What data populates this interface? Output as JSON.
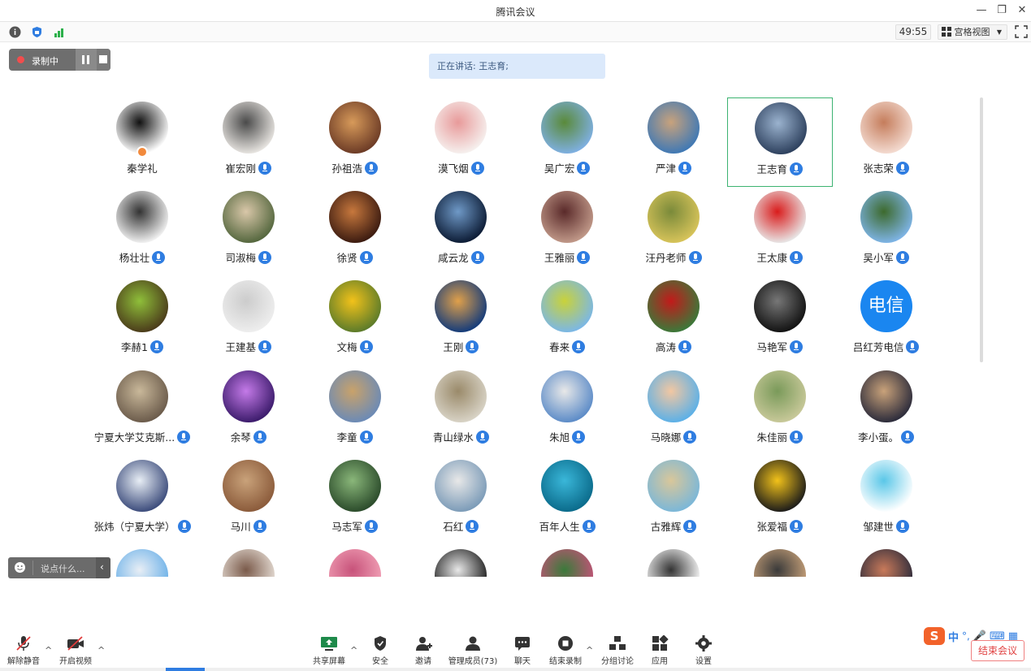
{
  "window": {
    "title": "腾讯会议"
  },
  "toolbar": {
    "timer": "49:55",
    "view_label": "宫格视图"
  },
  "recording": {
    "label": "录制中"
  },
  "speaking": "正在讲话: 王志育;",
  "chat_placeholder": "说点什么...",
  "participants": [
    {
      "name": "秦学礼",
      "colors": [
        "#ffffff",
        "#111111"
      ],
      "host": true
    },
    {
      "name": "崔宏刚",
      "colors": [
        "#e9e6e2",
        "#4a4a4a"
      ]
    },
    {
      "name": "孙祖浩",
      "colors": [
        "#6b3a25",
        "#d79a5a"
      ]
    },
    {
      "name": "漠飞烟",
      "colors": [
        "#f6f1ef",
        "#e89a9a"
      ]
    },
    {
      "name": "吴广宏",
      "colors": [
        "#7fb0e3",
        "#5a8a3a"
      ]
    },
    {
      "name": "严津",
      "colors": [
        "#3e78b5",
        "#c8a27c"
      ]
    },
    {
      "name": "王志育",
      "colors": [
        "#2c3f5c",
        "#9bb3cf"
      ],
      "active": true
    },
    {
      "name": "张志荣",
      "colors": [
        "#f4dcd2",
        "#c57d5c"
      ]
    },
    {
      "name": "杨壮壮",
      "colors": [
        "#f3f3f3",
        "#333333"
      ]
    },
    {
      "name": "司淑梅",
      "colors": [
        "#53663d",
        "#d9c7a9"
      ]
    },
    {
      "name": "徐贤",
      "colors": [
        "#3a1a10",
        "#c7783d"
      ]
    },
    {
      "name": "咸云龙",
      "colors": [
        "#0b1a33",
        "#6f99c7"
      ]
    },
    {
      "name": "王雅丽",
      "colors": [
        "#c29a8a",
        "#5a2a2a"
      ]
    },
    {
      "name": "汪丹老师",
      "colors": [
        "#d8c45a",
        "#7a8a3a"
      ]
    },
    {
      "name": "王太康",
      "colors": [
        "#e8e8e8",
        "#d91c1c"
      ]
    },
    {
      "name": "吴小军",
      "colors": [
        "#7fb5e8",
        "#3d6a2d"
      ]
    },
    {
      "name": "李赫1",
      "colors": [
        "#4a3a1a",
        "#8fbf3a"
      ]
    },
    {
      "name": "王建基",
      "colors": [
        "#eeeeee",
        "#cccccc"
      ]
    },
    {
      "name": "文梅",
      "colors": [
        "#5a7a2a",
        "#f2c21a"
      ]
    },
    {
      "name": "王刚",
      "colors": [
        "#123a7a",
        "#e0a04a"
      ]
    },
    {
      "name": "春来",
      "colors": [
        "#7ab7e8",
        "#c9d23a"
      ]
    },
    {
      "name": "高涛",
      "colors": [
        "#3a7a3a",
        "#c21a1a"
      ]
    },
    {
      "name": "马艳军",
      "colors": [
        "#111111",
        "#777777"
      ]
    },
    {
      "name": "吕红芳电信",
      "avatar_text": "电信",
      "colors": [
        "#1a86f0",
        "#1a86f0"
      ]
    },
    {
      "name": "宁夏大学艾克斯...",
      "colors": [
        "#6a5a4a",
        "#c9b89a"
      ]
    },
    {
      "name": "余琴",
      "colors": [
        "#3a1a6a",
        "#c47ae8"
      ]
    },
    {
      "name": "李童",
      "colors": [
        "#6a8ab7",
        "#c9a26a"
      ]
    },
    {
      "name": "青山绿水",
      "colors": [
        "#d9d4c7",
        "#9a8a6a"
      ]
    },
    {
      "name": "朱旭",
      "colors": [
        "#5a8ac7",
        "#e8e8e8"
      ]
    },
    {
      "name": "马晓娜",
      "colors": [
        "#5ab0e8",
        "#f2c7a2"
      ]
    },
    {
      "name": "朱佳丽",
      "colors": [
        "#c9c99a",
        "#7a9a5a"
      ]
    },
    {
      "name": "李小蛋。",
      "colors": [
        "#2a2a3a",
        "#c9a27a"
      ]
    },
    {
      "name": "张炜（宁夏大学）",
      "colors": [
        "#3a4a7a",
        "#e8eef5"
      ]
    },
    {
      "name": "马川",
      "colors": [
        "#8a5a3a",
        "#c9a27a"
      ]
    },
    {
      "name": "马志军",
      "colors": [
        "#2a4a2a",
        "#8ab77a"
      ]
    },
    {
      "name": "石红",
      "colors": [
        "#7a9ab7",
        "#e8e8e8"
      ]
    },
    {
      "name": "百年人生",
      "colors": [
        "#0a6a8a",
        "#3ab7d9"
      ]
    },
    {
      "name": "古雅辉",
      "colors": [
        "#7ab7d9",
        "#d9c79a"
      ]
    },
    {
      "name": "张爱福",
      "colors": [
        "#1a1a1a",
        "#f2c21a"
      ]
    },
    {
      "name": "邹建世",
      "colors": [
        "#ffffff",
        "#5ac7e8"
      ]
    },
    {
      "name": "",
      "colors": [
        "#6ab0e8",
        "#e8eef5"
      ]
    },
    {
      "name": "",
      "colors": [
        "#e8e0d8",
        "#7a5a4a"
      ]
    },
    {
      "name": "",
      "colors": [
        "#f2a2b7",
        "#c7527a"
      ]
    },
    {
      "name": "",
      "colors": [
        "#1a1a1a",
        "#e8e8e8"
      ]
    },
    {
      "name": "",
      "colors": [
        "#c7527a",
        "#3a7a3a"
      ]
    },
    {
      "name": "",
      "colors": [
        "#ffffff",
        "#333333"
      ]
    },
    {
      "name": "",
      "colors": [
        "#c9a27a",
        "#3a3a3a"
      ]
    },
    {
      "name": "",
      "colors": [
        "#2a2a3a",
        "#c97a5a"
      ]
    }
  ],
  "bottom": {
    "unmute": "解除静音",
    "start_video": "开启视频",
    "share": "共享屏幕",
    "security": "安全",
    "invite": "邀请",
    "manage": "管理成员(73)",
    "chat": "聊天",
    "end_record": "结束录制",
    "breakout": "分组讨论",
    "apps": "应用",
    "settings": "设置",
    "end_meeting": "结束会议"
  },
  "ime": {
    "mode": "中"
  },
  "colors": {
    "accent": "#2f7de1",
    "active_border": "#3cb371",
    "end": "#e04040"
  }
}
